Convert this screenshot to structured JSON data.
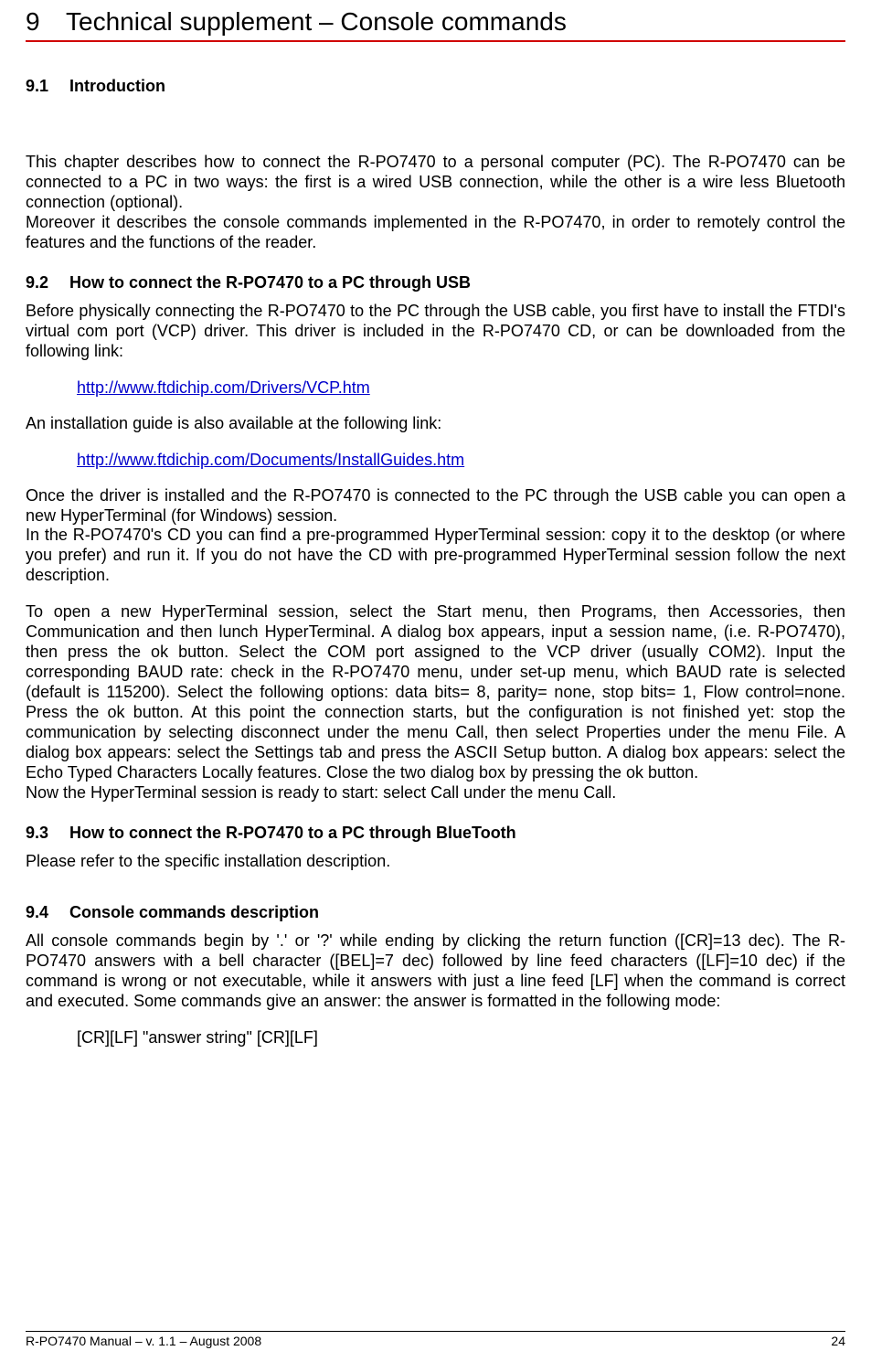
{
  "chapter": {
    "number": "9",
    "title": "Technical supplement – Console commands"
  },
  "sections": {
    "s91": {
      "num": "9.1",
      "title": "Introduction",
      "p1": "This chapter describes how to connect the R-PO7470 to a personal computer (PC). The R-PO7470 can be connected to a PC in two ways: the first is a wired USB connection, while the other is a wire less Bluetooth connection (optional).",
      "p2": "Moreover it describes the console commands implemented in the R-PO7470, in order to remotely control the features and the functions of the reader."
    },
    "s92": {
      "num": "9.2",
      "title": "How to connect the R-PO7470 to a PC through USB",
      "p1": "Before physically connecting the R-PO7470 to the PC through the USB cable, you first have to install the FTDI's virtual com port (VCP) driver. This driver is included in the R-PO7470 CD, or can be downloaded from the following link:",
      "link1": "http://www.ftdichip.com/Drivers/VCP.htm",
      "p2": "An installation guide is also available at the following link:",
      "link2": "http://www.ftdichip.com/Documents/InstallGuides.htm",
      "p3": "Once the driver is installed and the R-PO7470 is connected to the PC through the USB cable you can open a new HyperTerminal (for Windows) session.",
      "p4": "In the R-PO7470's CD you can find a pre-programmed HyperTerminal session: copy it to the desktop (or where you prefer) and run it. If you do not have the CD with pre-programmed HyperTerminal session follow the next description.",
      "p5": "To open a new HyperTerminal session, select the Start menu, then Programs, then Accessories, then Communication and then lunch HyperTerminal. A dialog box appears, input a session name, (i.e. R-PO7470), then press the ok button. Select the COM port assigned to the VCP driver (usually COM2). Input the corresponding BAUD rate: check in the R-PO7470 menu, under set-up menu, which BAUD rate is selected (default is 115200). Select the following options: data bits= 8, parity= none, stop bits= 1, Flow control=none. Press the ok button. At this point the connection starts, but the configuration is not finished yet: stop the communication by selecting disconnect under the menu Call, then select Properties under the menu File. A dialog box appears: select the Settings tab and press the ASCII Setup button. A dialog box appears: select the Echo Typed Characters Locally features. Close the two dialog box by pressing the ok button.",
      "p6": "Now the HyperTerminal session is ready to start: select Call under the menu Call."
    },
    "s93": {
      "num": "9.3",
      "title": "How to connect the R-PO7470 to a PC through BlueTooth",
      "p1": "Please refer to the specific installation description."
    },
    "s94": {
      "num": "9.4",
      "title": "Console commands description",
      "p1": "All console commands begin by '.' or '?' while ending by clicking the return function ([CR]=13 dec). The R-PO7470 answers with a bell character ([BEL]=7 dec) followed by line feed characters ([LF]=10 dec) if the command is wrong or not executable, while it answers with just a line feed [LF] when the command is correct and executed. Some commands give an answer: the answer is formatted in the following mode:",
      "code": "[CR][LF] \"answer string\" [CR][LF]"
    }
  },
  "footer": {
    "left": "R-PO7470 Manual – v. 1.1 – August 2008",
    "right": "24"
  }
}
